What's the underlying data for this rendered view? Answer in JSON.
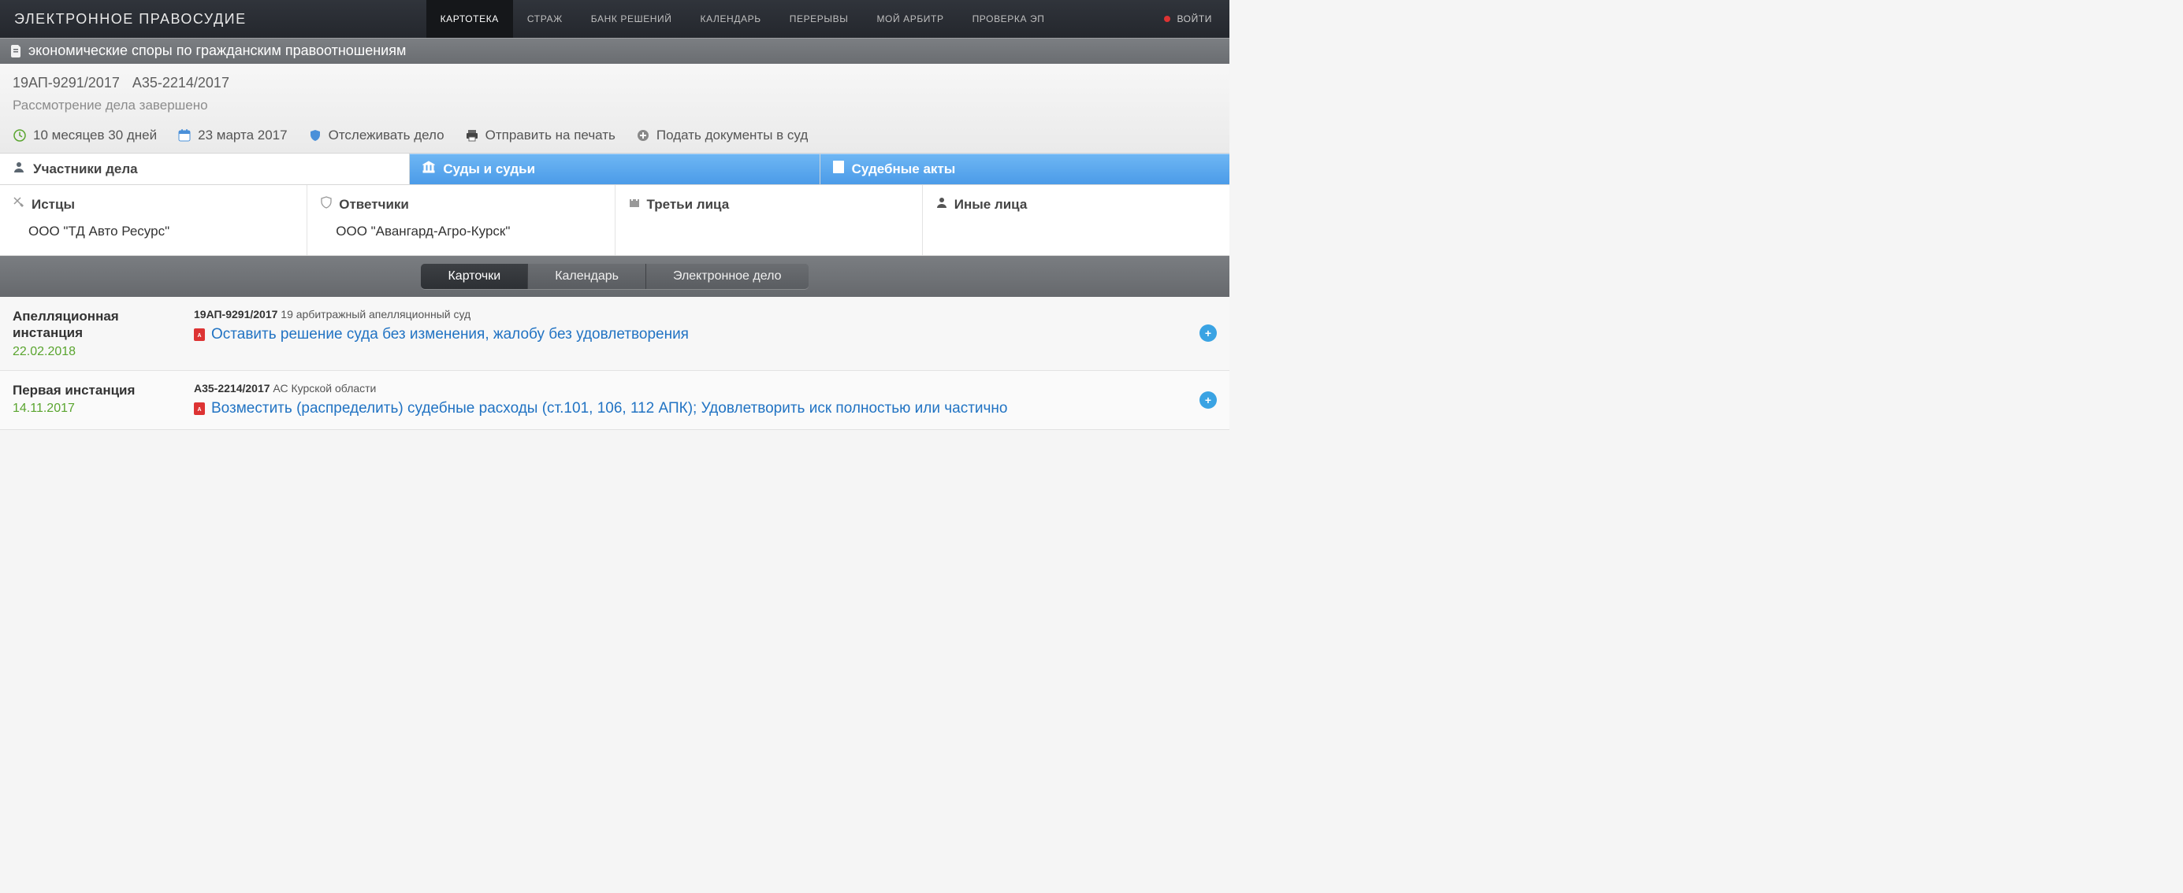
{
  "brand": "ЭЛЕКТРОННОЕ ПРАВОСУДИЕ",
  "nav": {
    "items": [
      {
        "label": "КАРТОТЕКА",
        "active": true
      },
      {
        "label": "СТРАЖ",
        "active": false
      },
      {
        "label": "БАНК РЕШЕНИЙ",
        "active": false
      },
      {
        "label": "КАЛЕНДАРЬ",
        "active": false
      },
      {
        "label": "ПЕРЕРЫВЫ",
        "active": false
      },
      {
        "label": "МОЙ АРБИТР",
        "active": false
      },
      {
        "label": "ПРОВЕРКА ЭП",
        "active": false
      }
    ],
    "login": "ВОЙТИ"
  },
  "category": "экономические споры по гражданским правоотношениям",
  "case": {
    "number_appeal": "19АП-9291/2017",
    "number_first": "А35-2214/2017",
    "status": "Рассмотрение дела завершено"
  },
  "actions": {
    "duration": "10 месяцев 30 дней",
    "filed_date": "23 марта 2017",
    "track": "Отслеживать дело",
    "print": "Отправить на печать",
    "file_docs": "Подать документы в суд"
  },
  "tabs": [
    {
      "label": "Участники дела",
      "active": true
    },
    {
      "label": "Суды и судьи",
      "active": false
    },
    {
      "label": "Судебные акты",
      "active": false
    }
  ],
  "parties": {
    "plaintiffs": {
      "title": "Истцы",
      "items": [
        "ООО \"ТД Авто Ресурс\""
      ]
    },
    "defendants": {
      "title": "Ответчики",
      "items": [
        "ООО \"Авангард-Агро-Курск\""
      ]
    },
    "third": {
      "title": "Третьи лица",
      "items": []
    },
    "other": {
      "title": "Иные лица",
      "items": []
    }
  },
  "segments": [
    {
      "label": "Карточки",
      "active": true
    },
    {
      "label": "Календарь",
      "active": false
    },
    {
      "label": "Электронное дело",
      "active": false
    }
  ],
  "instances": [
    {
      "title": "Апелляционная инстанция",
      "date": "22.02.2018",
      "case_no": "19АП-9291/2017",
      "court": "19 арбитражный апелляционный суд",
      "decision": "Оставить решение суда без изменения, жалобу без удовлетворения"
    },
    {
      "title": "Первая инстанция",
      "date": "14.11.2017",
      "case_no": "А35-2214/2017",
      "court": "АС Курской области",
      "decision": "Возместить (распределить) судебные расходы (ст.101, 106, 112 АПК); Удовлетворить иск полностью или частично"
    }
  ]
}
